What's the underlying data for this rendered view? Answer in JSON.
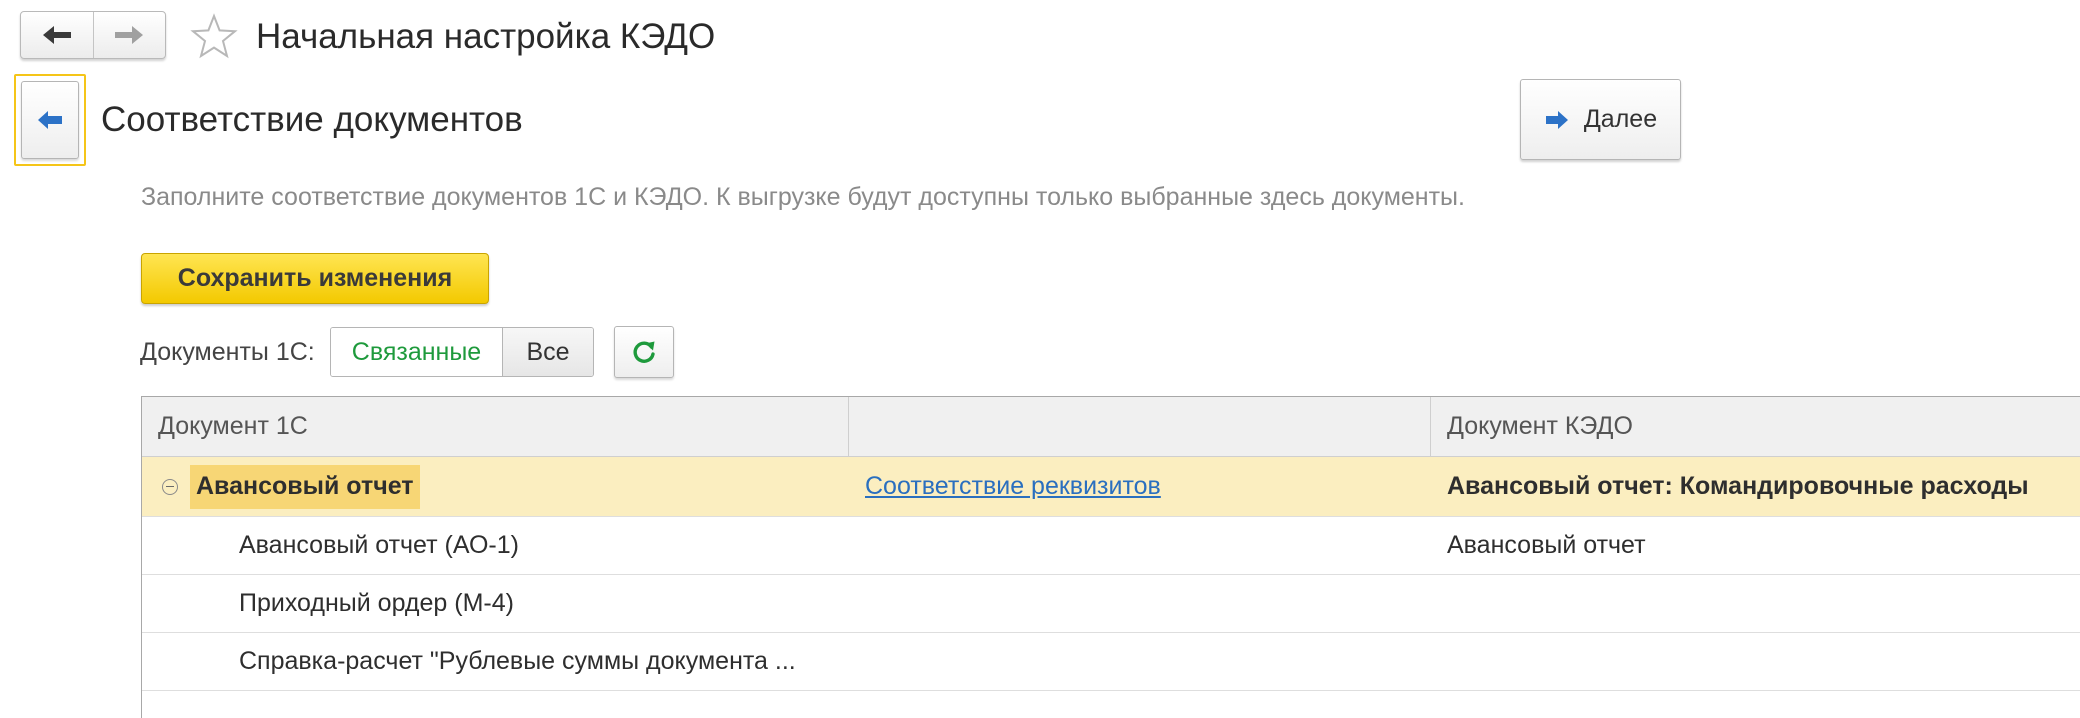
{
  "window": {
    "title": "Начальная настройка КЭДО"
  },
  "nav": {
    "back_icon": "arrow-left-icon",
    "forward_icon": "arrow-right-icon",
    "favorite_icon": "star-icon"
  },
  "page": {
    "subtitle": "Соответствие документов",
    "next_label": "Далее",
    "hint": "Заполните соответствие документов 1С и КЭДО. К выгрузке будут доступны только выбранные здесь документы.",
    "save_label": "Сохранить изменения"
  },
  "filter": {
    "label": "Документы 1С:",
    "options": [
      "Связанные",
      "Все"
    ],
    "selected": "Связанные"
  },
  "colors": {
    "accent_yellow": "#f3c900",
    "group_row": "#fbeec0",
    "link": "#2a6fbf",
    "active_filter": "#1e9a3c"
  },
  "table": {
    "columns": [
      "Документ 1С",
      "",
      "Документ КЭДО"
    ],
    "group": {
      "name": "Авансовый отчет",
      "link": "Соответствие реквизитов",
      "kedo": "Авансовый отчет: Командировочные расходы"
    },
    "rows": [
      {
        "doc": "Авансовый отчет (АО-1)",
        "kedo": "Авансовый отчет"
      },
      {
        "doc": "Приходный ордер (М-4)",
        "kedo": ""
      },
      {
        "doc": "Справка-расчет \"Рублевые суммы документа ...",
        "kedo": ""
      }
    ]
  }
}
